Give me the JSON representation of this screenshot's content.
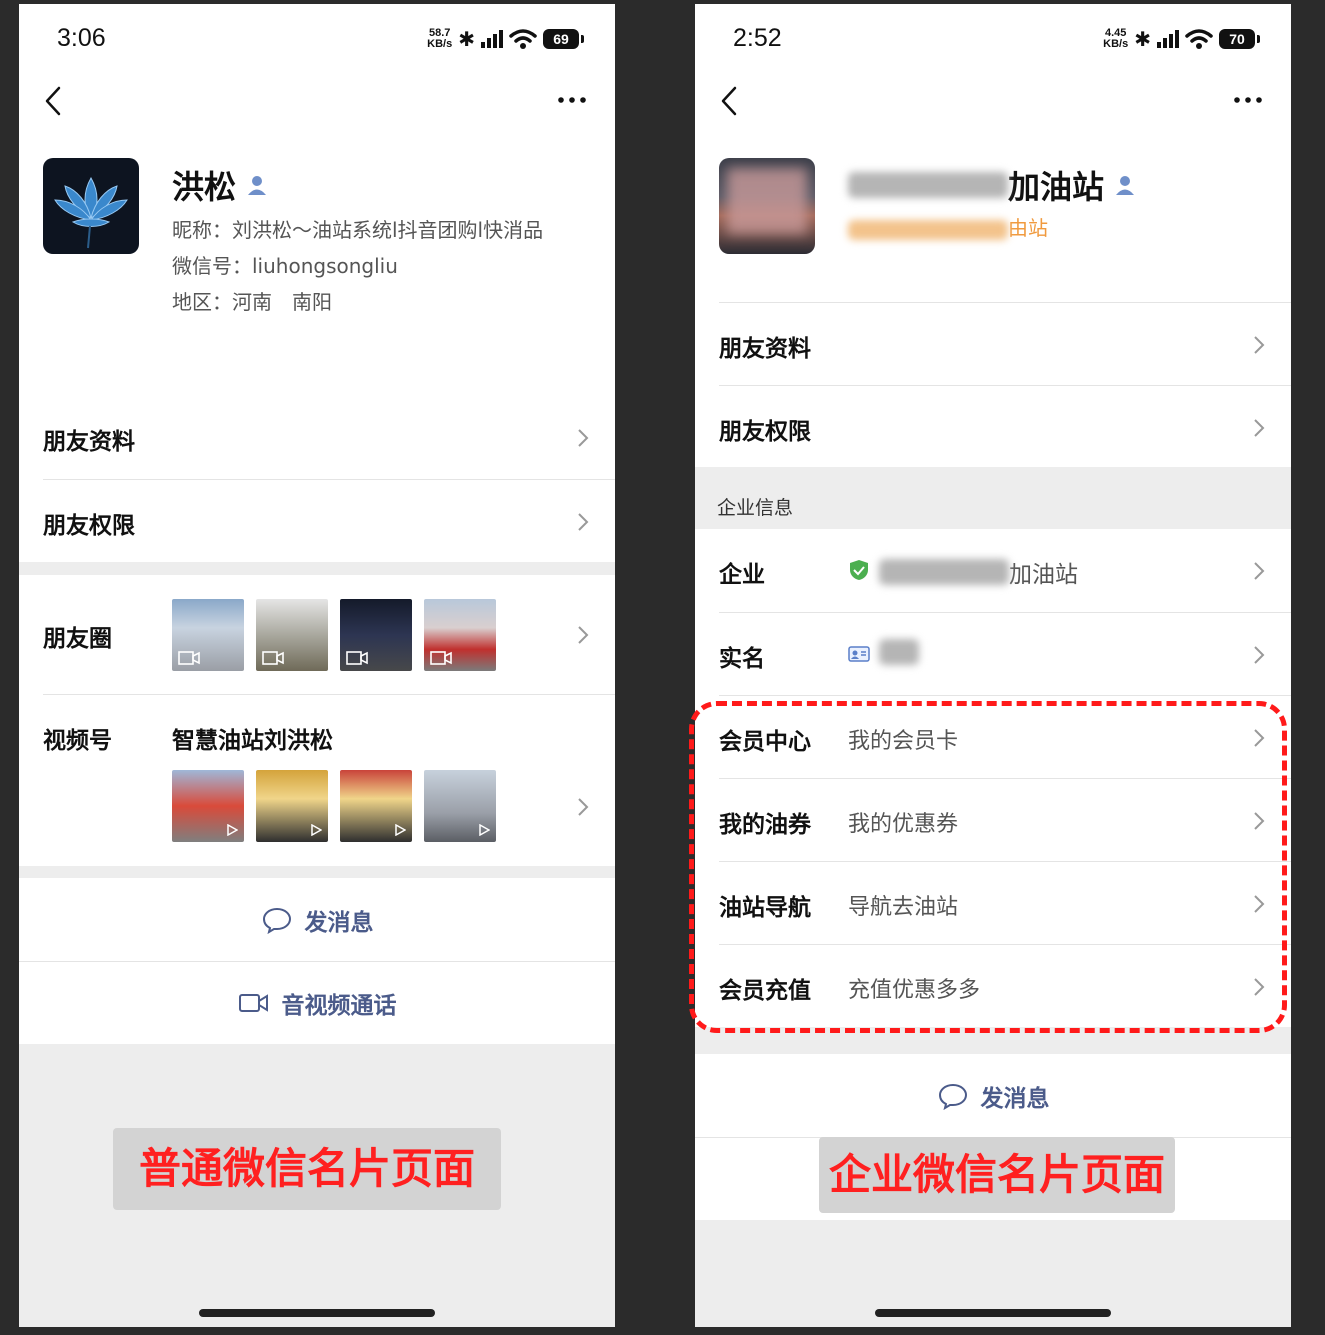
{
  "left": {
    "status": {
      "time": "3:06",
      "net_speed": "58.7",
      "net_unit": "KB/s",
      "battery": "69"
    },
    "profile": {
      "name": "洪松",
      "nickname": "昵称：刘洪松～油站系统l抖音团购l快消品",
      "wechat_id": "微信号：liuhongsongliu",
      "region": "地区：河南　南阳"
    },
    "rows": {
      "friend_info": "朋友资料",
      "friend_perm": "朋友权限",
      "moments": "朋友圈",
      "channels": "视频号",
      "channels_name": "智慧油站刘洪松"
    },
    "actions": {
      "message": "发消息",
      "call": "音视频通话"
    },
    "caption": "普通微信名片页面"
  },
  "right": {
    "status": {
      "time": "2:52",
      "net_speed": "4.45",
      "net_unit": "KB/s",
      "battery": "70"
    },
    "profile": {
      "name_suffix": "加油站",
      "sub_suffix": "由站"
    },
    "rows": {
      "friend_info": "朋友资料",
      "friend_perm": "朋友权限"
    },
    "section_title": "企业信息",
    "enterprise": {
      "label": "企业",
      "value_suffix": "加油站"
    },
    "realname": {
      "label": "实名"
    },
    "services": [
      {
        "label": "会员中心",
        "value": "我的会员卡"
      },
      {
        "label": "我的油券",
        "value": "我的优惠券"
      },
      {
        "label": "油站导航",
        "value": "导航去油站"
      },
      {
        "label": "会员充值",
        "value": "充值优惠多多"
      }
    ],
    "actions": {
      "message": "发消息"
    },
    "caption": "企业微信名片页面"
  },
  "colors": {
    "caption_red": "#ff2020",
    "action_blue": "#4b5b8a",
    "verified_green": "#4caf50",
    "dash_red": "#ff1a1a"
  },
  "icons": [
    "back-arrow-icon",
    "more-dots-icon",
    "person-icon",
    "chevron-right-icon",
    "message-icon",
    "video-call-icon",
    "shield-check-icon",
    "id-card-icon",
    "video-camera-icon",
    "play-icon"
  ]
}
